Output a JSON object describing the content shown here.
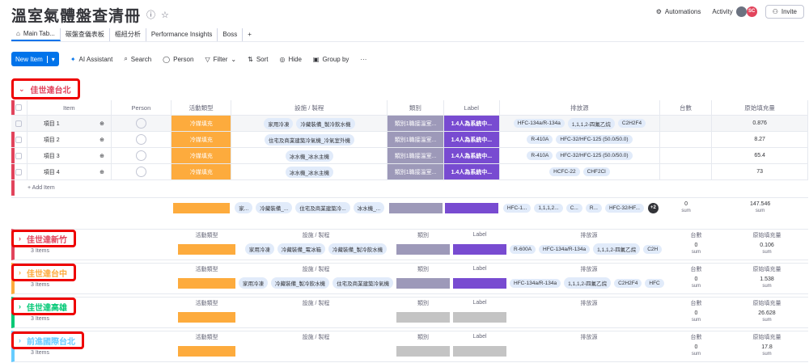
{
  "header": {
    "title": "溫室氣體盤查清冊",
    "automations": "Automations",
    "activity": "Activity",
    "avatar_initials": "SC",
    "invite": "Invite"
  },
  "tabs": [
    {
      "label": "Main Tab..."
    },
    {
      "label": "碳盤查儀表板"
    },
    {
      "label": "樞紐分析"
    },
    {
      "label": "Performance Insights"
    },
    {
      "label": "Boss"
    },
    {
      "label": "+"
    }
  ],
  "toolbar": {
    "new_item": "New Item",
    "ai": "AI Assistant",
    "search": "Search",
    "person": "Person",
    "filter": "Filter",
    "sort": "Sort",
    "hide": "Hide",
    "group_by": "Group by",
    "more": "···"
  },
  "columns": {
    "item": "Item",
    "person": "Person",
    "activity": "活動類型",
    "equipment": "設施 / 製程",
    "category": "類別",
    "label": "Label",
    "source": "排放源",
    "count": "台數",
    "fill": "原始填充量"
  },
  "groups": [
    {
      "name": "佳世達台北",
      "color": "#e2445c",
      "items": [
        {
          "name": "項目 1",
          "activity": "冷媒填充",
          "equipment": [
            "家用冷凍",
            "冷藏裝備_製冷飲水機"
          ],
          "category": "類別1職接溫室...",
          "label": "1.4人為系統中...",
          "sources": [
            "HFC-134a/R-134a",
            "1,1,1,2-四氟乙烷",
            "C2H2F4"
          ],
          "count": "",
          "fill": "0.876"
        },
        {
          "name": "項目 2",
          "activity": "冷媒填充",
          "equipment": [
            "住宅及商業建築冷氣機_冷氣室外機"
          ],
          "category": "類別1職接溫室...",
          "label": "1.4人為系統中...",
          "sources": [
            "R-410A",
            "HFC-32/HFC-125 (50.0/50.0)"
          ],
          "count": "",
          "fill": "8.27"
        },
        {
          "name": "項目 3",
          "activity": "冷媒填充",
          "equipment": [
            "冰水機_冰水主機"
          ],
          "category": "類別1職接溫室...",
          "label": "1.4人為系統中...",
          "sources": [
            "R-410A",
            "HFC-32/HFC-125 (50.0/50.0)"
          ],
          "count": "",
          "fill": "65.4"
        },
        {
          "name": "項目 4",
          "activity": "冷媒填充",
          "equipment": [
            "冰水機_冰水主機"
          ],
          "category": "類別1職接溫室...",
          "label": "1.4人為系統中...",
          "sources": [
            "HCFC-22",
            "CHF2Cl"
          ],
          "count": "",
          "fill": "73"
        }
      ],
      "add_item": "+ Add Item",
      "summary": {
        "equipment": [
          "家...",
          "冷藏裝備_...",
          "住宅及商業建築冷...",
          "冰水機_..."
        ],
        "sources": [
          "HFC-1...",
          "1,1,1,2...",
          "C...",
          "R...",
          "HFC-32/HF..."
        ],
        "more": "+2",
        "count": "0",
        "fill": "147.546",
        "sum_label": "sum"
      }
    },
    {
      "name": "佳世達新竹",
      "color": "#e2445c",
      "item_count": "3 Items",
      "summary": {
        "equipment": [
          "家用冷凍",
          "冷藏裝備_電冰箱",
          "冷藏裝備_製冷飲水機"
        ],
        "sources": [
          "R-600A",
          "HFC-134a/R-134a",
          "1,1,1,2-四氟乙烷",
          "C2H"
        ],
        "count": "0",
        "fill": "0.106"
      }
    },
    {
      "name": "佳世達台中",
      "color": "#fdab3d",
      "item_count": "3 Items",
      "summary": {
        "equipment": [
          "家用冷凍",
          "冷藏裝備_製冷飲水機",
          "住宅及商業建築冷氣機"
        ],
        "sources": [
          "HFC-134a/R-134a",
          "1,1,1,2-四氟乙烷",
          "C2H2F4",
          "HFC"
        ],
        "count": "0",
        "fill": "1.538"
      }
    },
    {
      "name": "佳世達高雄",
      "color": "#00c875",
      "item_count": "3 Items",
      "summary": {
        "equipment": [],
        "sources": [],
        "count": "0",
        "fill": "26.628"
      }
    },
    {
      "name": "前進國際台北",
      "color": "#66ccff",
      "item_count": "3 Items",
      "summary": {
        "equipment": [],
        "sources": [],
        "count": "0",
        "fill": "17.8"
      }
    }
  ],
  "colors": {
    "accent": "#0073ea",
    "orange": "#fdab3d",
    "category_gray": "#9d99b9",
    "label_purple": "#784bd1",
    "empty_gray": "#c4c4c4"
  }
}
